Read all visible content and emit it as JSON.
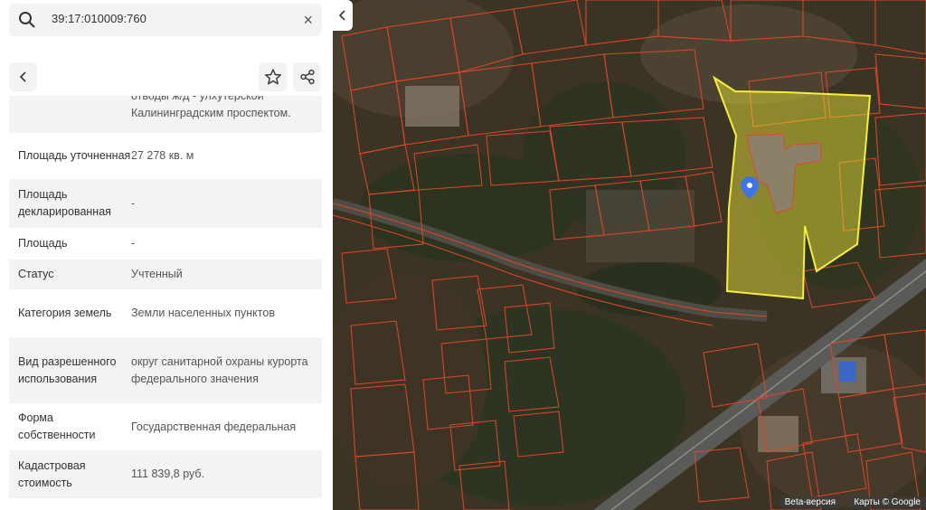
{
  "search": {
    "query": "39:17:010009:760",
    "icon": "search-icon",
    "clear": "×"
  },
  "toolbar": {
    "back_icon": "chevron-left-icon",
    "favorite_icon": "star-icon",
    "share_icon": "share-icon"
  },
  "details": {
    "cut_line1": "отводы ж/д - улхутерской",
    "cut_line2": "Калининградским проспектом.",
    "rows": [
      {
        "label": "Площадь уточненная",
        "value": "27 278 кв. м"
      },
      {
        "label": "Площадь декларированная",
        "value": "-"
      },
      {
        "label": "Площадь",
        "value": "-"
      },
      {
        "label": "Статус",
        "value": "Учтенный"
      },
      {
        "label": "Категория земель",
        "value": "Земли населенных пунктов"
      },
      {
        "label": "Вид разрешенного использования",
        "value": "округ санитарной охраны курорта федерального значения"
      },
      {
        "label": "Форма собственности",
        "value": "Государственная федеральная"
      },
      {
        "label": "Кадастровая стоимость",
        "value": "111 839,8 руб."
      }
    ]
  },
  "map": {
    "collapse_icon": "chevron-left-icon",
    "beta_label": "Beta-версия",
    "attribution": "Карты © Google",
    "marker_icon": "location-pin-icon",
    "parcel_color": "#f6ee3a",
    "boundary_color": "#e2462a"
  }
}
